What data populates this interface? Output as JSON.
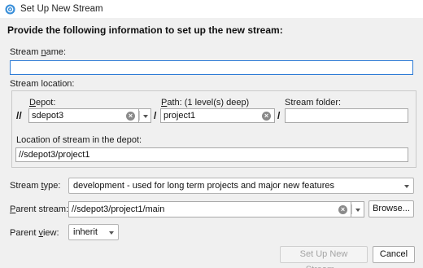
{
  "window": {
    "title": "Set Up New Stream"
  },
  "heading": "Provide the following information to set up the new stream:",
  "stream_name": {
    "label_pre": "Stream ",
    "label_u": "n",
    "label_post": "ame:",
    "value": ""
  },
  "stream_location": {
    "label": "Stream location:",
    "depot": {
      "label_u": "D",
      "label_post": "epot:",
      "prefix": "//",
      "value": "sdepot3"
    },
    "path": {
      "label_u": "P",
      "label_post": "ath: (1 level(s) deep)",
      "separator": "/",
      "value": "project1"
    },
    "folder": {
      "label": "Stream folder:",
      "separator": "/",
      "value": ""
    },
    "location_label": "Location of stream in the depot:",
    "location_value": "//sdepot3/project1"
  },
  "stream_type": {
    "label_pre": "Stream ",
    "label_u": "t",
    "label_post": "ype:",
    "value": "development - used for long term projects and major new features"
  },
  "parent_stream": {
    "label_u": "P",
    "label_post": "arent stream:",
    "value": "//sdepot3/project1/main",
    "browse_label": "Browse..."
  },
  "parent_view": {
    "label_pre": "Parent ",
    "label_u": "v",
    "label_post": "iew:",
    "value": "inherit"
  },
  "buttons": {
    "setup": "Set Up New Stream...",
    "cancel": "Cancel"
  },
  "icons": {
    "app": "stream-app-icon",
    "clear": "clear-icon",
    "dropdown": "chevron-down-icon"
  },
  "colors": {
    "focus_border": "#2d7bd6",
    "app_icon": "#3a8fd9"
  }
}
